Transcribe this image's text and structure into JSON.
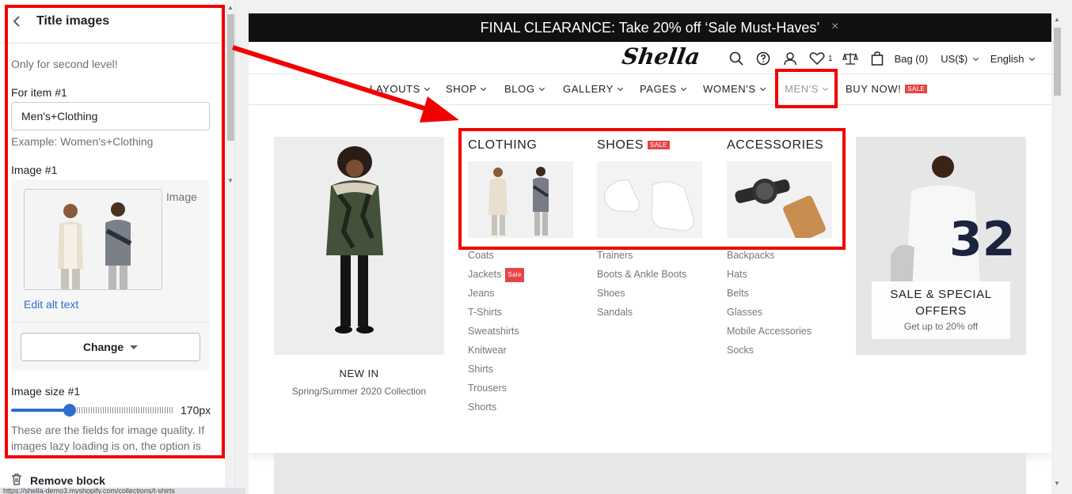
{
  "editor": {
    "title": "Title images",
    "note": "Only for second level!",
    "item_label": "For item #1",
    "item_value": "Men's+Clothing",
    "item_help": "Example: Women's+Clothing",
    "image_label": "Image #1",
    "image_word": "Image",
    "alt_link": "Edit alt text",
    "change_btn": "Change",
    "size_label": "Image size #1",
    "size_value": "170px",
    "size_fraction": 0.36,
    "quality_text": "These are the fields for image quality. If images lazy loading is on, the option is",
    "remove_block": "Remove block",
    "status_url": "https://shella-demo3.myshopify.com/collections/t-shirts"
  },
  "store": {
    "banner": "FINAL CLEARANCE: Take 20% off ‘Sale Must-Haves’",
    "banner_close": "×",
    "logo": "Shella",
    "wishlist_count": "1",
    "bag": "Bag (0)",
    "currency": "US($)",
    "language": "English",
    "nav": [
      {
        "label": "LAYOUTS"
      },
      {
        "label": "SHOP"
      },
      {
        "label": "BLOG"
      },
      {
        "label": "GALLERY"
      },
      {
        "label": "PAGES"
      },
      {
        "label": "WOMEN'S"
      },
      {
        "label": "MEN'S"
      },
      {
        "label": "BUY NOW!",
        "badge": "SALE"
      }
    ],
    "promo_left": {
      "title": "NEW IN",
      "subtitle": "Spring/Summer 2020 Collection"
    },
    "columns": [
      {
        "title": "CLOTHING",
        "links": [
          "Coats",
          "Jackets",
          "Jeans",
          "T-Shirts",
          "Sweatshirts",
          "Knitwear",
          "Shirts",
          "Trousers",
          "Shorts"
        ],
        "link_badge": "Sale"
      },
      {
        "title": "SHOES",
        "badge": "SALE",
        "links": [
          "Trainers",
          "Boots & Ankle Boots",
          "Shoes",
          "Sandals"
        ]
      },
      {
        "title": "ACCESSORIES",
        "links": [
          "Backpacks",
          "Hats",
          "Belts",
          "Glasses",
          "Mobile Accessories",
          "Socks"
        ]
      }
    ],
    "promo_right": {
      "title_line1": "SALE & SPECIAL",
      "title_line2": "OFFERS",
      "subtitle": "Get up to 20% off"
    }
  },
  "colors": {
    "annotation": "#f20000",
    "accent": "#2c6ecb",
    "sale": "#e64545"
  },
  "icons": [
    "chevron-left-icon",
    "search-icon",
    "help-icon",
    "user-icon",
    "heart-icon",
    "compare-icon",
    "bag-icon",
    "trash-icon",
    "close-icon"
  ]
}
